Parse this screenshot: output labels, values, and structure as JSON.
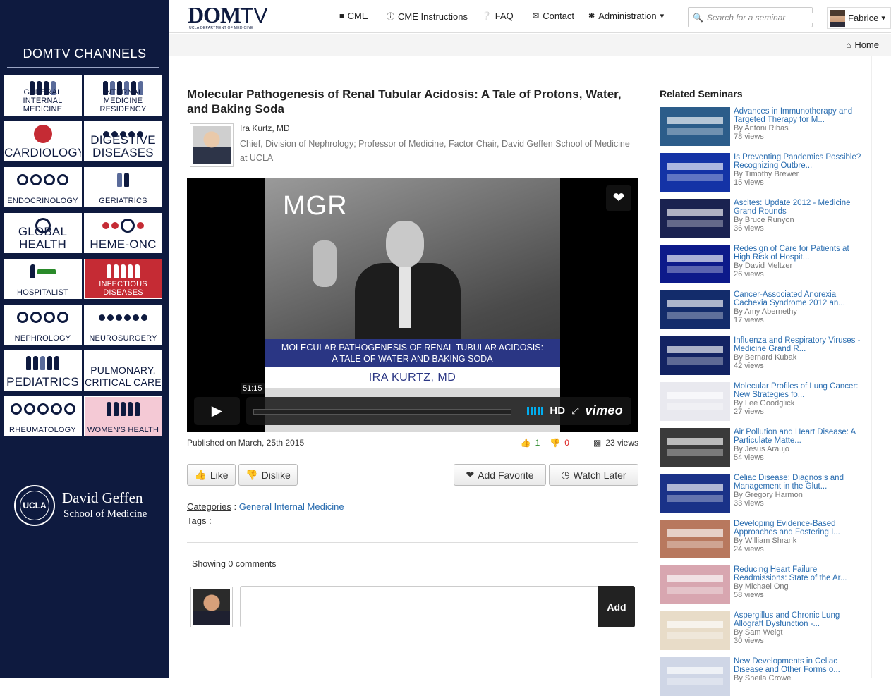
{
  "sidebar": {
    "title": "DOMTV CHANNELS",
    "channels": [
      {
        "label": "GENERAL INTERNAL MEDICINE",
        "style": "normal"
      },
      {
        "label": "INTERNAL MEDICINE RESIDENCY",
        "style": "normal"
      },
      {
        "label": "CARDIOLOGY",
        "style": "big"
      },
      {
        "label": "DIGESTIVE DISEASES",
        "style": "big"
      },
      {
        "label": "ENDOCRINOLOGY",
        "style": "normal"
      },
      {
        "label": "GERIATRICS",
        "style": "normal"
      },
      {
        "label": "GLOBAL HEALTH",
        "style": "big"
      },
      {
        "label": "HEME-ONC",
        "style": "big"
      },
      {
        "label": "HOSPITALIST",
        "style": "normal"
      },
      {
        "label": "INFECTIOUS DISEASES",
        "style": "red"
      },
      {
        "label": "NEPHROLOGY",
        "style": "normal"
      },
      {
        "label": "NEUROSURGERY",
        "style": "normal"
      },
      {
        "label": "PEDIATRICS",
        "style": "big"
      },
      {
        "label": "PULMONARY, CRITICAL CARE",
        "style": "normal"
      },
      {
        "label": "RHEUMATOLOGY",
        "style": "normal"
      },
      {
        "label": "WOMEN'S HEALTH",
        "style": "normal"
      }
    ],
    "logo": {
      "seal": "UCLA",
      "line1": "David Geffen",
      "line2": "School of Medicine"
    }
  },
  "nav": {
    "brand_main": "DOM",
    "brand_tv": "TV",
    "brand_sub": "UCLA DEPARTMENT OF MEDICINE",
    "links": [
      "CME",
      "CME Instructions",
      "FAQ",
      "Contact",
      "Administration"
    ],
    "search_placeholder": "Search for a seminar",
    "user": "Fabrice"
  },
  "breadcrumb": {
    "home": "Home"
  },
  "seminar": {
    "title": "Molecular Pathogenesis of Renal Tubular Acidosis: A Tale of Protons, Water, and Baking Soda",
    "speaker": "Ira Kurtz, MD",
    "role": "Chief, Division of Nephrology; Professor of Medicine, Factor Chair, David Geffen School of Medicine at UCLA",
    "video": {
      "mgr": "MGR",
      "banner_line1": "MOLECULAR PATHOGENESIS OF RENAL TUBULAR ACIDOSIS:",
      "banner_line2": "A TALE OF WATER AND BAKING SODA",
      "name": "IRA KURTZ, MD",
      "duration": "51:15",
      "hd": "HD",
      "vimeo": "vimeo"
    },
    "published": "Published on March, 25th 2015",
    "likes": "1",
    "dislikes": "0",
    "views": "23 views",
    "buttons": {
      "like": "Like",
      "dislike": "Dislike",
      "favorite": "Add Favorite",
      "later": "Watch Later"
    },
    "categories_label": "Categories",
    "category": "General Internal Medicine",
    "tags_label": "Tags",
    "comments_count": "Showing 0 comments",
    "add_label": "Add"
  },
  "related": {
    "heading": "Related Seminars",
    "items": [
      {
        "title": "Advances in Immunotherapy and Targeted Therapy for M...",
        "by": "By Antoni Ribas",
        "views": "78 views",
        "thumb": "#2c5d8a"
      },
      {
        "title": "Is Preventing Pandemics Possible? Recognizing Outbre...",
        "by": "By Timothy Brewer",
        "views": "15 views",
        "thumb": "#1433a6"
      },
      {
        "title": "Ascites: Update 2012 - Medicine Grand Rounds",
        "by": "By Bruce Runyon",
        "views": "36 views",
        "thumb": "#1a2250"
      },
      {
        "title": "Redesign of Care for Patients at High Risk of Hospit...",
        "by": "By David Meltzer",
        "views": "26 views",
        "thumb": "#0d1a8a"
      },
      {
        "title": "Cancer-Associated Anorexia Cachexia Syndrome 2012 an...",
        "by": "By Amy Abernethy",
        "views": "17 views",
        "thumb": "#132c6b"
      },
      {
        "title": "Influenza and Respiratory Viruses - Medicine Grand R...",
        "by": "By Bernard Kubak",
        "views": "42 views",
        "thumb": "#132363"
      },
      {
        "title": "Molecular Profiles of Lung Cancer: New Strategies fo...",
        "by": "By Lee Goodglick",
        "views": "27 views",
        "thumb": "#e9e9ef"
      },
      {
        "title": "Air Pollution and Heart Disease: A Particulate Matte...",
        "by": "By Jesus Araujo",
        "views": "54 views",
        "thumb": "#3a3a3a"
      },
      {
        "title": "Celiac Disease: Diagnosis and Management in the Glut...",
        "by": "By Gregory Harmon",
        "views": "33 views",
        "thumb": "#1a3288"
      },
      {
        "title": "Developing Evidence-Based Approaches and Fostering I...",
        "by": "By William Shrank",
        "views": "24 views",
        "thumb": "#b8785e"
      },
      {
        "title": "Reducing Heart Failure Readmissions: State of the Ar...",
        "by": "By Michael Ong",
        "views": "58 views",
        "thumb": "#d8a6b0"
      },
      {
        "title": "Aspergillus and Chronic Lung Allograft Dysfunction -...",
        "by": "By Sam Weigt",
        "views": "30 views",
        "thumb": "#e8dcc8"
      },
      {
        "title": "New Developments in Celiac Disease and Other Forms o...",
        "by": "By Sheila Crowe",
        "views": "",
        "thumb": "#cfd6e6"
      }
    ]
  }
}
